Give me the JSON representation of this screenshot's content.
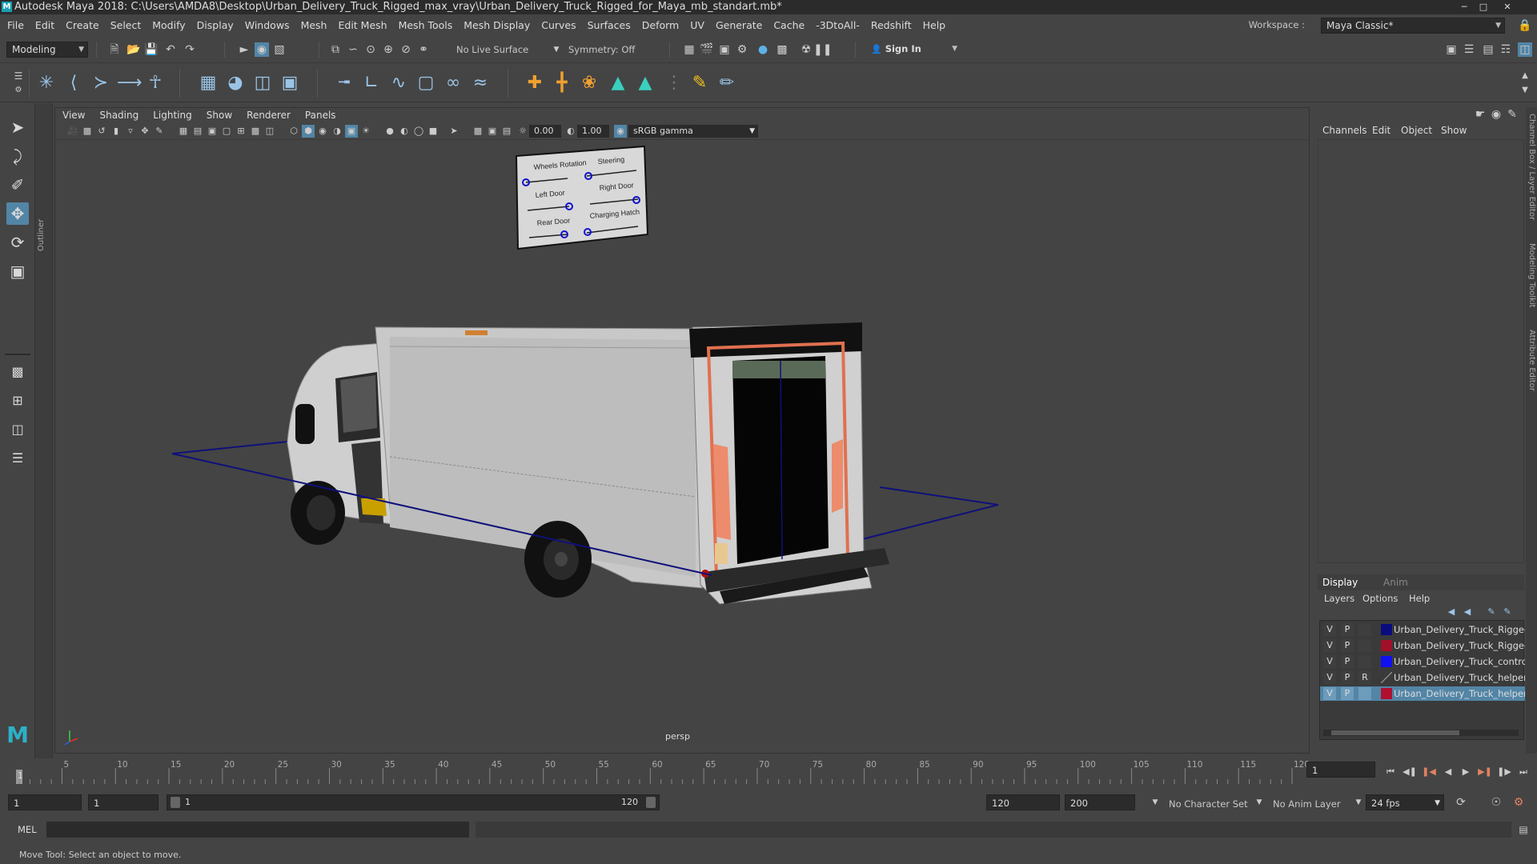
{
  "window": {
    "title": "Autodesk Maya 2018: C:\\Users\\AMDA8\\Desktop\\Urban_Delivery_Truck_Rigged_max_vray\\Urban_Delivery_Truck_Rigged_for_Maya_mb_standart.mb*",
    "logo_letter": "M"
  },
  "menubar": {
    "items": [
      "File",
      "Edit",
      "Create",
      "Select",
      "Modify",
      "Display",
      "Windows",
      "Mesh",
      "Edit Mesh",
      "Mesh Tools",
      "Mesh Display",
      "Curves",
      "Surfaces",
      "Deform",
      "UV",
      "Generate",
      "Cache",
      "-3DtoAll-",
      "Redshift",
      "Help"
    ],
    "workspace_label": "Workspace :",
    "workspace_value": "Maya Classic*"
  },
  "statusline": {
    "menuset": "Modeling",
    "live_surface": "No Live Surface",
    "symmetry": "Symmetry: Off",
    "sign_in": "Sign In"
  },
  "viewport": {
    "menus": [
      "View",
      "Shading",
      "Lighting",
      "Show",
      "Renderer",
      "Panels"
    ],
    "exposure": "0.00",
    "gamma": "1.00",
    "color_space": "sRGB gamma",
    "camera_label": "persp",
    "control_board": {
      "labels": [
        "Wheels Rotation",
        "Steering",
        "Left Door",
        "Right Door",
        "Rear Door",
        "Charging Hatch"
      ]
    }
  },
  "outliner_tab": "Outliner",
  "channel_box": {
    "tabs": [
      "Channels",
      "Edit",
      "Object",
      "Show"
    ]
  },
  "side_tabs": [
    "Channel Box / Layer Editor",
    "Modeling Toolkit",
    "Attribute Editor"
  ],
  "layer_editor": {
    "tabs": [
      "Display",
      "Anim"
    ],
    "menus": [
      "Layers",
      "Options",
      "Help"
    ],
    "layers": [
      {
        "v": "V",
        "p": "P",
        "r": "",
        "color": "#0b0b80",
        "name": "Urban_Delivery_Truck_Rigged_"
      },
      {
        "v": "V",
        "p": "P",
        "r": "",
        "color": "#a0102a",
        "name": "Urban_Delivery_Truck_Rigged_"
      },
      {
        "v": "V",
        "p": "P",
        "r": "",
        "color": "#1010f0",
        "name": "Urban_Delivery_Truck_controll"
      },
      {
        "v": "V",
        "p": "P",
        "r": "R",
        "color": "",
        "name": "Urban_Delivery_Truck_helpers_"
      },
      {
        "v": "V",
        "p": "P",
        "r": "",
        "color": "#b01030",
        "name": "Urban_Delivery_Truck_helpers"
      }
    ]
  },
  "timeline": {
    "ticks": [
      "5",
      "10",
      "15",
      "20",
      "25",
      "30",
      "35",
      "40",
      "45",
      "50",
      "55",
      "60",
      "65",
      "70",
      "75",
      "80",
      "85",
      "90",
      "95",
      "100",
      "105",
      "110",
      "115",
      "120"
    ],
    "first_tick": "1",
    "current_frame": "1"
  },
  "range": {
    "start": "1",
    "playback_start": "1",
    "slider_start": "1",
    "slider_end": "120",
    "playback_end": "120",
    "end": "200",
    "character_set": "No Character Set",
    "anim_layer": "No Anim Layer",
    "fps": "24 fps"
  },
  "cmdline": {
    "label": "MEL"
  },
  "helpline": {
    "text": "Move Tool: Select an object to move."
  }
}
